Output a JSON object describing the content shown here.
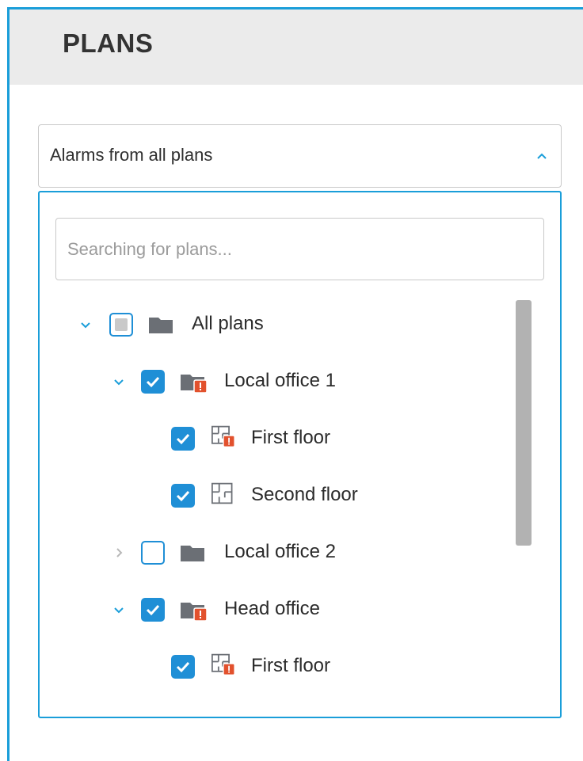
{
  "header": {
    "title": "PLANS"
  },
  "filter_select": {
    "value": "Alarms from all plans",
    "expanded": true
  },
  "search": {
    "placeholder": "Searching for plans...",
    "value": ""
  },
  "tree": {
    "all_plans": {
      "label": "All plans",
      "state": "partial",
      "expanded": true
    },
    "local_office_1": {
      "label": "Local office 1",
      "state": "checked",
      "expanded": true,
      "alarm": true
    },
    "lo1_first_floor": {
      "label": "First floor",
      "state": "checked",
      "alarm": true
    },
    "lo1_second_floor": {
      "label": "Second floor",
      "state": "checked",
      "alarm": false
    },
    "local_office_2": {
      "label": "Local office 2",
      "state": "unchecked",
      "expanded": false,
      "alarm": false
    },
    "head_office": {
      "label": "Head office",
      "state": "checked",
      "expanded": true,
      "alarm": true
    },
    "ho_first_floor": {
      "label": "First floor",
      "state": "checked",
      "alarm": true
    }
  },
  "colors": {
    "accent": "#1a9ed9",
    "checkbox": "#1f8fd6",
    "alarm": "#e2512d",
    "folder": "#6b6f75"
  }
}
